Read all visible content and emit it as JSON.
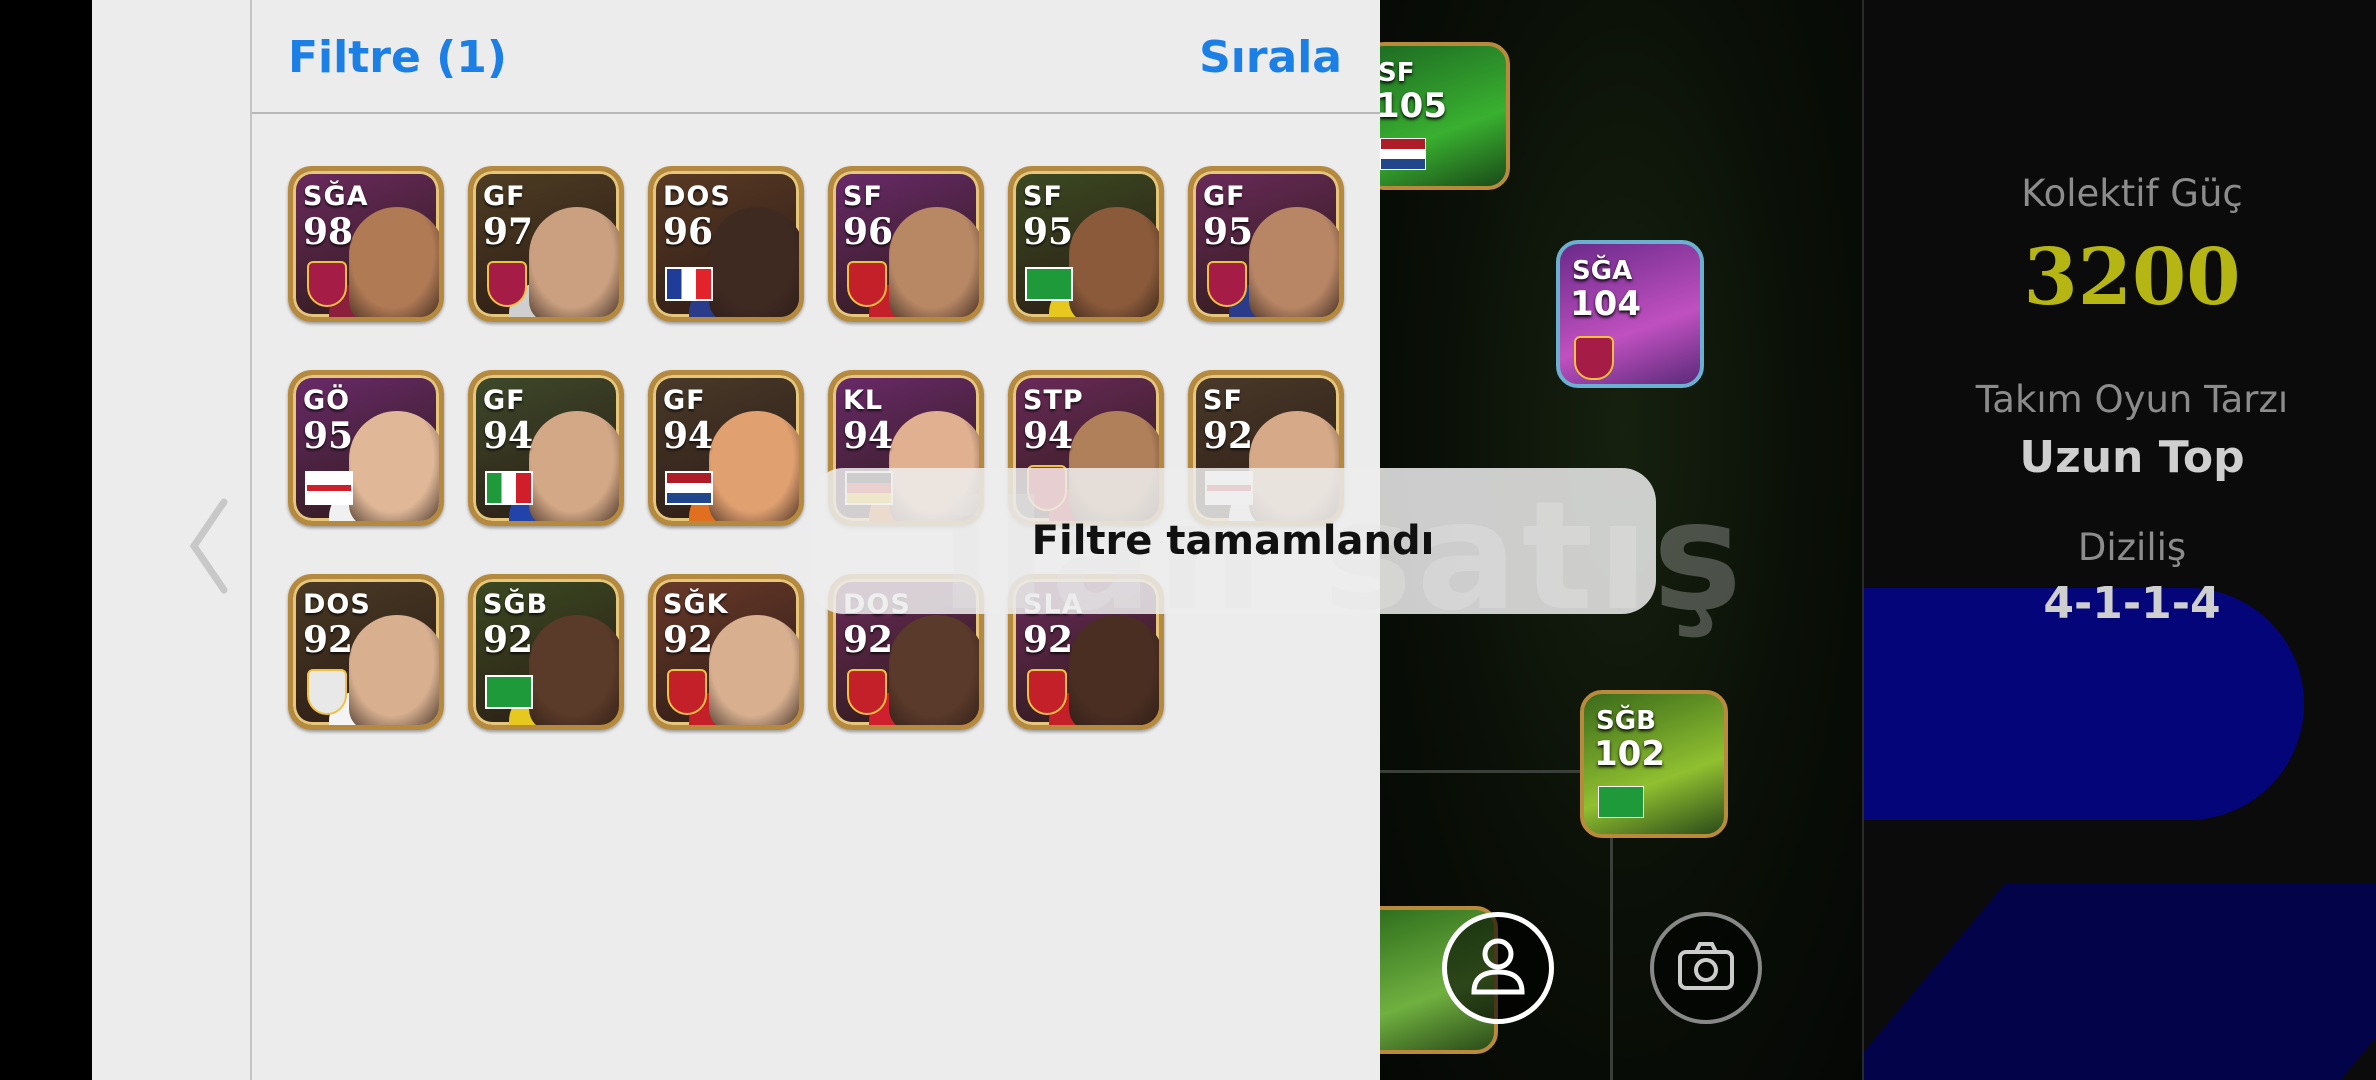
{
  "filter_panel": {
    "title": "Filtre (1)",
    "sort_label": "Sırala"
  },
  "players": [
    {
      "position": "SĞA",
      "rating": "98",
      "badge": "club-crest",
      "bg": "#6b2a5f",
      "face": "#b07a55",
      "shirt": "#8c1f3c",
      "crest": "#a51c46"
    },
    {
      "position": "GF",
      "rating": "97",
      "badge": "club-crest",
      "bg": "#4e3d23",
      "face": "#caa080",
      "shirt": "#cfcfcf",
      "crest": "#a51c46"
    },
    {
      "position": "DOS",
      "rating": "96",
      "badge": "flag-france",
      "bg": "#5a3a25",
      "face": "#3f2a22",
      "shirt": "#2a3b8a"
    },
    {
      "position": "SF",
      "rating": "96",
      "badge": "club-crest",
      "bg": "#6a2a6a",
      "face": "#b88865",
      "shirt": "#c4202a",
      "crest": "#c4202a"
    },
    {
      "position": "SF",
      "rating": "95",
      "badge": "flag-brazil",
      "bg": "#3b4a22",
      "face": "#8a5a3a",
      "shirt": "#e6c81e"
    },
    {
      "position": "GF",
      "rating": "95",
      "badge": "club-crest",
      "bg": "#6a2a5a",
      "face": "#b88665",
      "shirt": "#2a3b8a",
      "crest": "#a51c46"
    },
    {
      "position": "GÖ",
      "rating": "95",
      "badge": "flag-england",
      "bg": "#6a2a6a",
      "face": "#e0b898",
      "shirt": "#f0f0f0"
    },
    {
      "position": "GF",
      "rating": "94",
      "badge": "flag-italy",
      "bg": "#3e4a2a",
      "face": "#d3a886",
      "shirt": "#2244aa"
    },
    {
      "position": "GF",
      "rating": "94",
      "badge": "flag-netherlands",
      "bg": "#4a3a2a",
      "face": "#e0a070",
      "shirt": "#e07020"
    },
    {
      "position": "KL",
      "rating": "94",
      "badge": "flag-germany",
      "bg": "#6a2a6a",
      "face": "#e0b090",
      "shirt": "#e07020"
    },
    {
      "position": "STP",
      "rating": "94",
      "badge": "club-crest",
      "bg": "#6a2a5a",
      "face": "#b0805a",
      "shirt": "#c4202a",
      "crest": "#c4202a"
    },
    {
      "position": "SF",
      "rating": "92",
      "badge": "flag-england",
      "bg": "#4a3a2a",
      "face": "#d6aa88",
      "shirt": "#f0f0f0"
    },
    {
      "position": "DOS",
      "rating": "92",
      "badge": "club-crest",
      "bg": "#4a3a25",
      "face": "#d8b090",
      "shirt": "#f4f4f4",
      "crest": "#e8e8e8"
    },
    {
      "position": "SĞB",
      "rating": "92",
      "badge": "flag-brazil",
      "bg": "#3b4a22",
      "face": "#5a3a28",
      "shirt": "#e6c81e"
    },
    {
      "position": "SĞK",
      "rating": "92",
      "badge": "club-crest",
      "bg": "#6a3a2a",
      "face": "#d8b090",
      "shirt": "#c4202a",
      "crest": "#c4202a"
    },
    {
      "position": "DOS",
      "rating": "92",
      "badge": "club-crest",
      "bg": "#6a2a5a",
      "face": "#5a3a2a",
      "shirt": "#d02030",
      "crest": "#c4202a"
    },
    {
      "position": "SLA",
      "rating": "92",
      "badge": "club-crest",
      "bg": "#6a2a5a",
      "face": "#4a2e22",
      "shirt": "#c4202a",
      "crest": "#c4202a"
    }
  ],
  "toast": {
    "text": "Filtre tamamlandı"
  },
  "team_panel": {
    "power_label": "Kolektif Güç",
    "power_value": "3200",
    "style_label": "Takım Oyun Tarzı",
    "style_value": "Uzun Top",
    "formation_label": "Diziliş",
    "formation_value": "4-1-1-4"
  },
  "field_cards": [
    {
      "position": "SF",
      "rating": "105",
      "badge": "flag-netherlands"
    },
    {
      "position": "SĞA",
      "rating": "104",
      "badge": "club-crest"
    },
    {
      "position": "SĞB",
      "rating": "102",
      "badge": "flag-brazil"
    }
  ],
  "colors": {
    "accent": "#1c7fe6",
    "power": "#b5b513",
    "card_border": "#b58a3e"
  },
  "icons": [
    "chevron-left-icon",
    "user-icon",
    "camera-icon"
  ]
}
